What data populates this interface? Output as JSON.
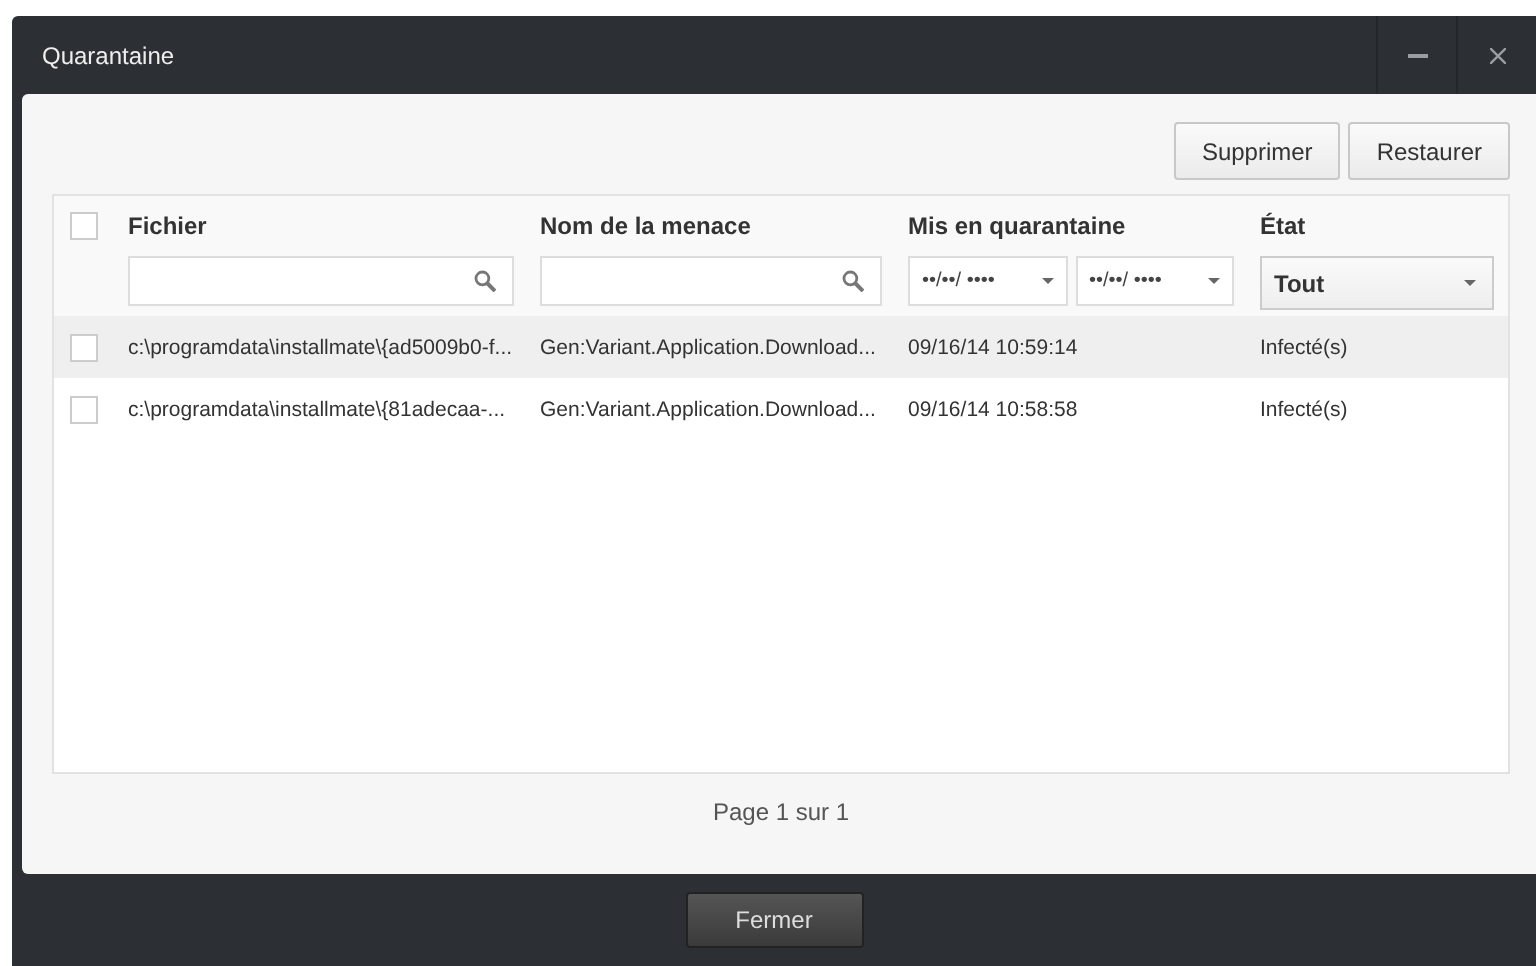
{
  "window": {
    "title": "Quarantaine"
  },
  "toolbar": {
    "buttons": [
      "Supprimer",
      "Restaurer"
    ]
  },
  "table": {
    "select_all": {
      "checked": false
    },
    "columns": [
      {
        "label": "Fichier",
        "kind": "search"
      },
      {
        "label": "Nom de la menace",
        "kind": "search"
      },
      {
        "label": "Mis en quarantaine",
        "kind": "dates",
        "from": "••/••/ ••••",
        "to": "••/••/ ••••"
      },
      {
        "label": "État",
        "kind": "select",
        "value": "Tout"
      }
    ],
    "rows": [
      {
        "selected": true,
        "checked": false,
        "cells": [
          "c:\\programdata\\installmate\\{ad5009b0-f...",
          "Gen:Variant.Application.Download...",
          "09/16/14 10:59:14",
          "Infecté(s)"
        ]
      },
      {
        "selected": false,
        "checked": false,
        "cells": [
          "c:\\programdata\\installmate\\{81adecaa-...",
          "Gen:Variant.Application.Download...",
          "09/16/14 10:58:58",
          "Infecté(s)"
        ]
      }
    ]
  },
  "pagination": "Page 1 sur 1",
  "footer": {
    "button": "Fermer"
  }
}
